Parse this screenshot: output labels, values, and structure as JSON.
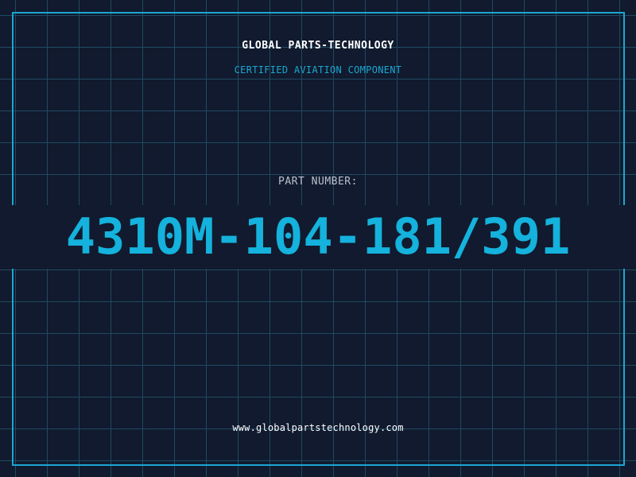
{
  "header": {
    "company_name": "GLOBAL PARTS-TECHNOLOGY",
    "subtitle": "CERTIFIED AVIATION COMPONENT"
  },
  "part": {
    "label": "PART NUMBER:",
    "number": "4310M-104-181/391"
  },
  "footer": {
    "website": "www.globalpartstechnology.com"
  },
  "colors": {
    "background": "#111a2e",
    "grid": "#1f4a63",
    "accent": "#1aa7d1",
    "part_number": "#14b2dc",
    "text_light": "#ffffff",
    "text_muted": "#b8c1cc"
  }
}
